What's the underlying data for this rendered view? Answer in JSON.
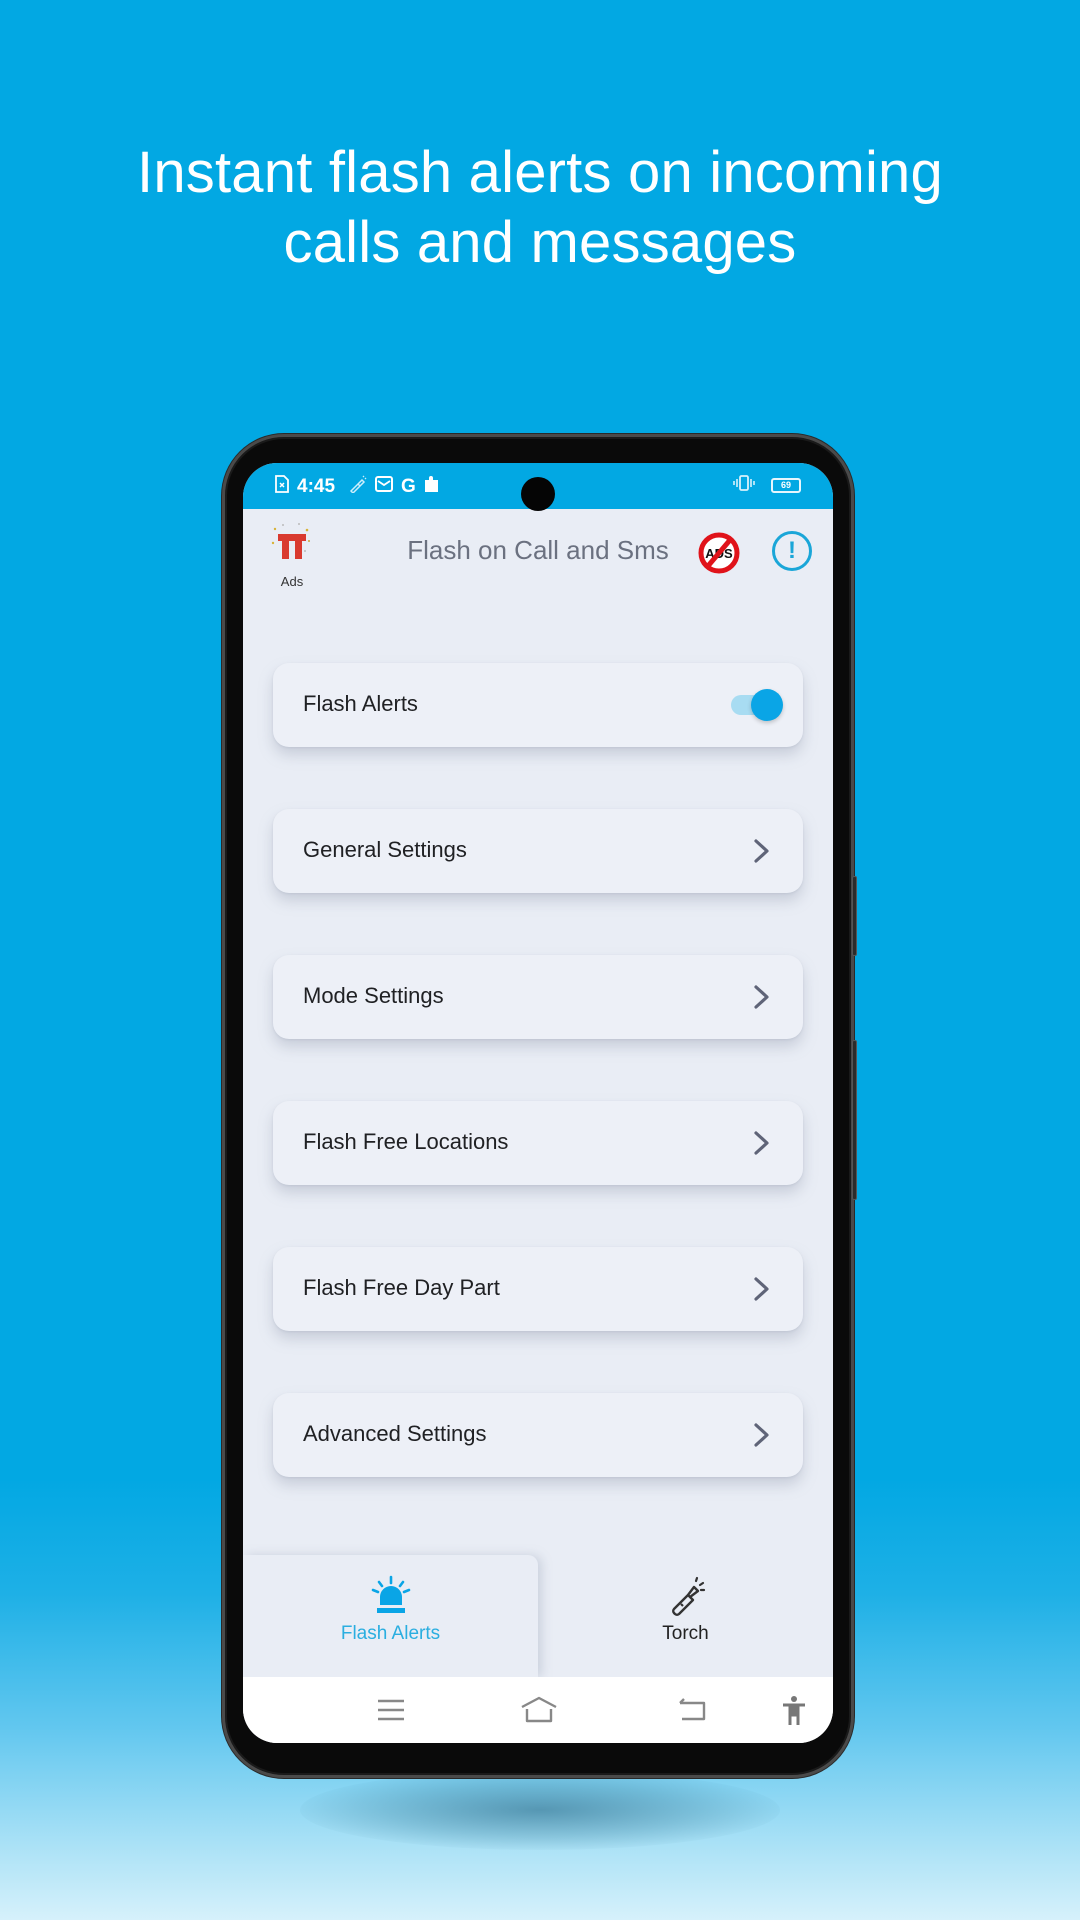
{
  "headline": {
    "line1": "Instant flash alerts on incoming",
    "line2": "calls and messages"
  },
  "status_bar": {
    "time": "4:45",
    "left_icons": [
      "sim-missing-icon",
      "flashlight-icon",
      "mail-icon",
      "google-icon",
      "puzzle-icon"
    ],
    "google_glyph": "G",
    "right_icons": [
      "vibrate-icon",
      "battery-icon"
    ],
    "battery_level": "69"
  },
  "app_header": {
    "ads_label": "Ads",
    "title": "Flash on Call and Sms",
    "no_ads_text": "ADS",
    "info_glyph": "!"
  },
  "menu": {
    "items": [
      {
        "label": "Flash Alerts",
        "type": "toggle",
        "enabled": true
      },
      {
        "label": "General Settings",
        "type": "link"
      },
      {
        "label": "Mode Settings",
        "type": "link"
      },
      {
        "label": "Flash Free Locations",
        "type": "link"
      },
      {
        "label": "Flash Free Day Part",
        "type": "link"
      },
      {
        "label": "Advanced Settings",
        "type": "link"
      }
    ]
  },
  "bottom_nav": {
    "tabs": [
      {
        "label": "Flash Alerts",
        "icon": "siren-icon",
        "active": true
      },
      {
        "label": "Torch",
        "icon": "flashlight-icon",
        "active": false
      }
    ]
  },
  "system_nav": [
    "menu-icon",
    "home-icon",
    "back-icon",
    "accessibility-icon"
  ],
  "colors": {
    "background": "#02a8e3",
    "accent": "#0aa5e6",
    "active_tab_label": "#2aaee0",
    "screen_bg": "#e9edf5",
    "card_bg": "#edf0f7",
    "chevron": "#5f6478",
    "no_ads_red": "#e0131a"
  }
}
